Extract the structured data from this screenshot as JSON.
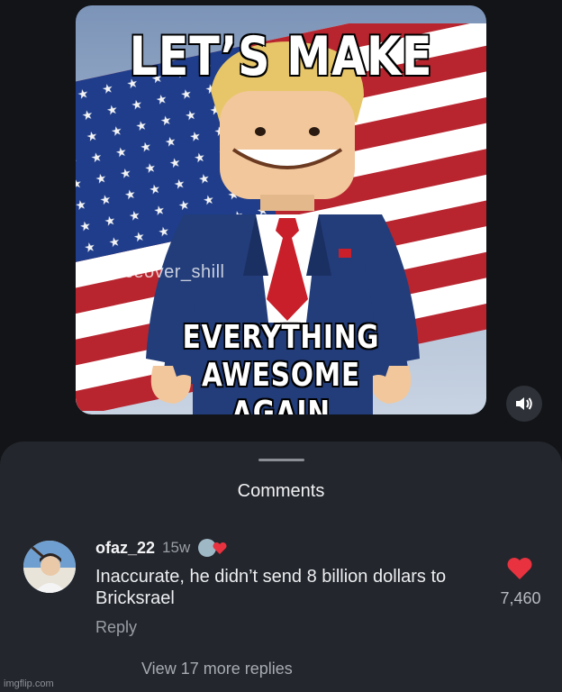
{
  "post": {
    "meme_top_text": "LET’S MAKE",
    "meme_bottom_text": "EVERYTHING AWESOME AGAIN",
    "meme_bottom_line1": "EVERYTHING AWESOME",
    "meme_bottom_line2": "AGAIN",
    "watermark": "@voiceover_shill",
    "sound_icon": "speaker-icon"
  },
  "comments_sheet": {
    "title": "Comments",
    "comment": {
      "username": "ofaz_22",
      "time": "15w",
      "text": "Inaccurate, he didn’t send 8 billion dollars to Bricksrael",
      "reply_label": "Reply",
      "like_icon": "heart-icon",
      "like_count": "7,460",
      "like_color": "#e8323f"
    },
    "view_more_label": "View 17 more replies"
  },
  "footer": {
    "watermark": "imgflip.com"
  }
}
